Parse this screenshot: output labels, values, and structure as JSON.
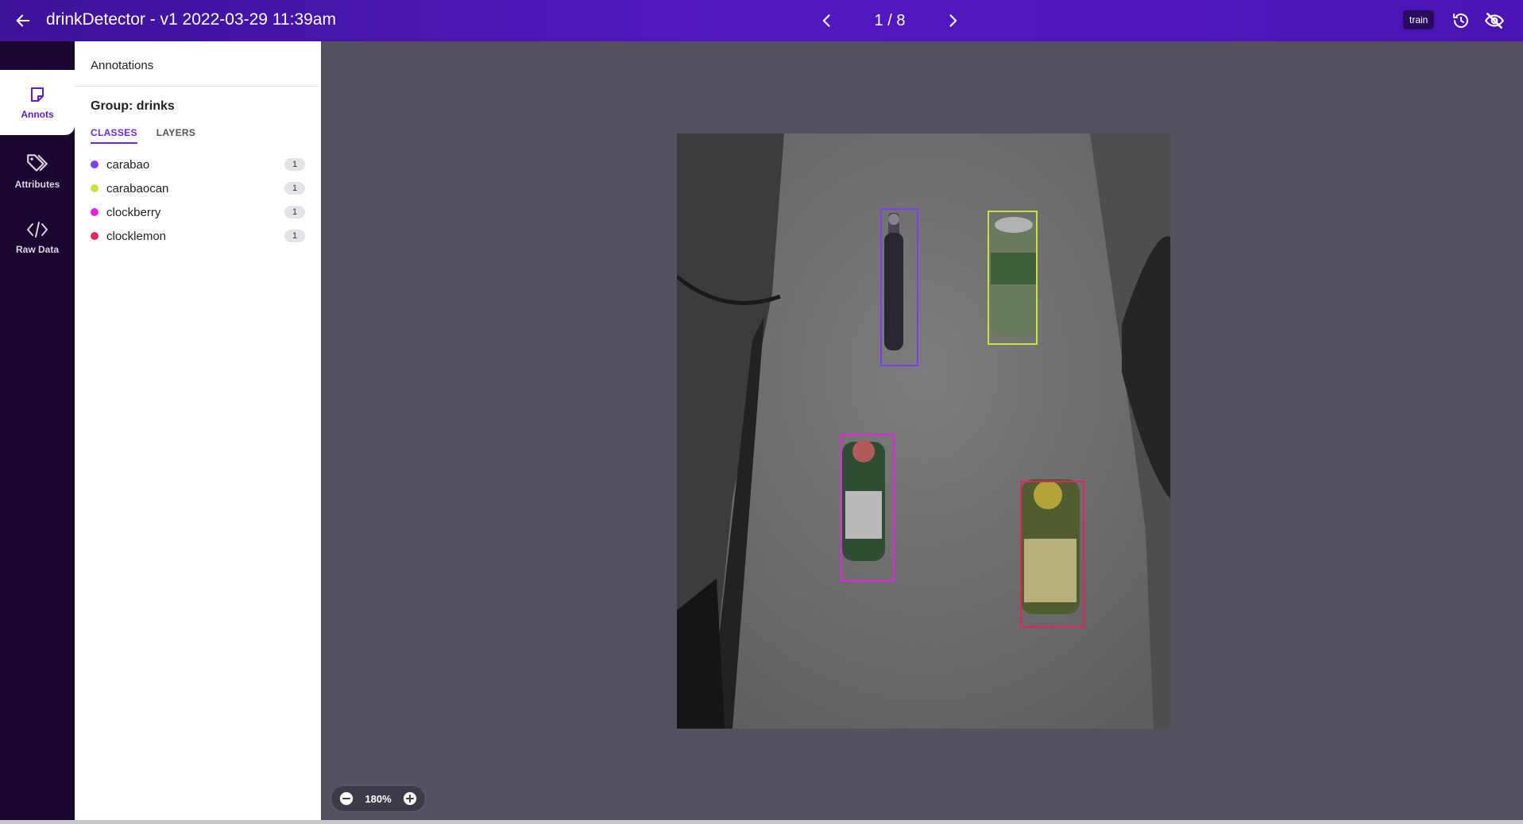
{
  "header": {
    "title": "drinkDetector - v1 2022-03-29 11:39am",
    "pager": "1 / 8",
    "split_badge": "train"
  },
  "icons": {
    "back": "arrow-left-icon",
    "prev": "chevron-left-icon",
    "next": "chevron-right-icon",
    "history": "history-icon",
    "visibility": "eye-off-icon",
    "annots": "sticky-note-icon",
    "attributes": "tags-icon",
    "raw_data": "code-icon",
    "zoom_out": "minus-circle-icon",
    "zoom_in": "plus-circle-icon"
  },
  "rail": {
    "items": [
      {
        "label": "Annots",
        "active": true
      },
      {
        "label": "Attributes",
        "active": false
      },
      {
        "label": "Raw Data",
        "active": false
      }
    ]
  },
  "panel": {
    "header": "Annotations",
    "group_title": "Group: drinks",
    "tabs": [
      {
        "label": "CLASSES",
        "active": true
      },
      {
        "label": "LAYERS",
        "active": false
      }
    ],
    "classes": [
      {
        "name": "carabao",
        "count": "1",
        "color": "#7b3ff2"
      },
      {
        "name": "carabaocan",
        "count": "1",
        "color": "#c6e337"
      },
      {
        "name": "clockberry",
        "count": "1",
        "color": "#e024e8"
      },
      {
        "name": "clocklemon",
        "count": "1",
        "color": "#e0265f"
      }
    ]
  },
  "canvas": {
    "zoom": "180%"
  },
  "colors": {
    "header_bg": "#4a16b8",
    "rail_bg": "#1b0630",
    "accent": "#6a2ce0",
    "canvas_bg": "#52525e"
  }
}
